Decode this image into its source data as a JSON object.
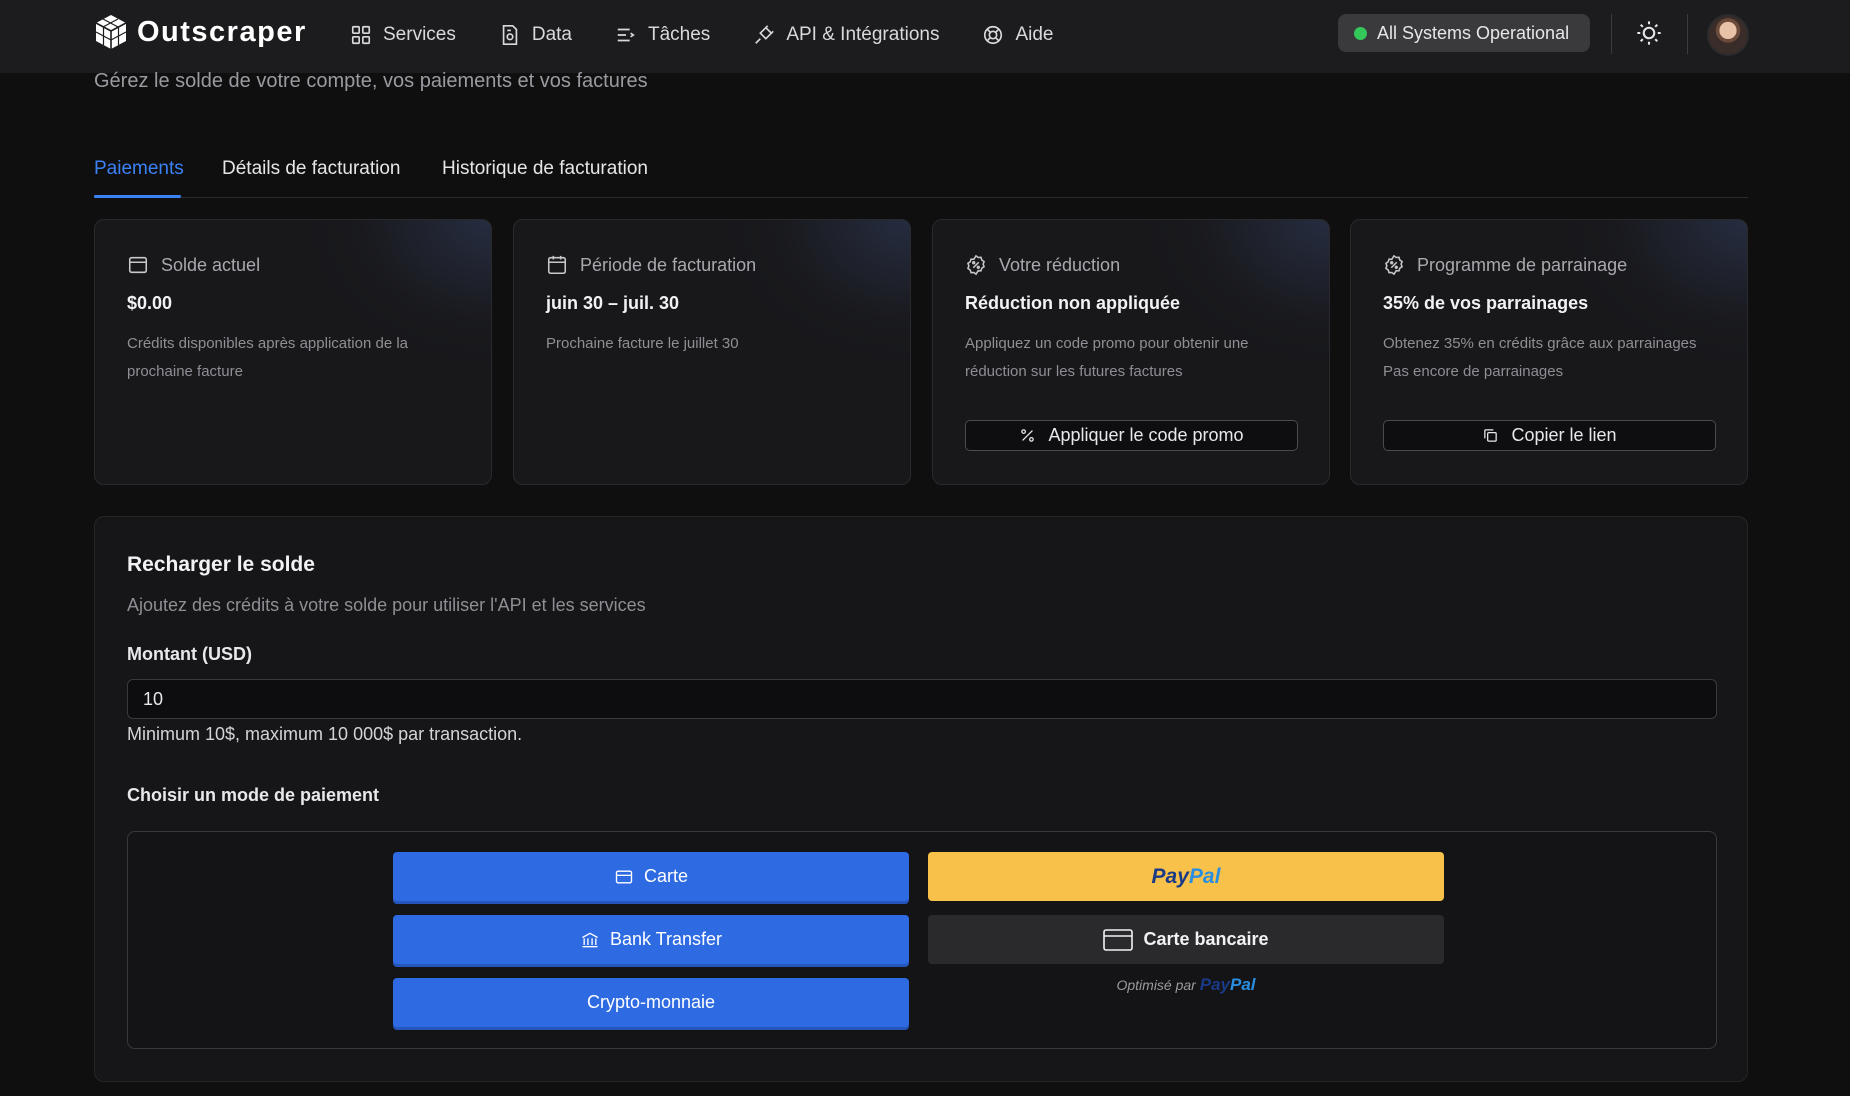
{
  "nav": {
    "brand": "Outscraper",
    "items": [
      {
        "label": "Services",
        "icon": "grid-icon"
      },
      {
        "label": "Data",
        "icon": "data-file-icon"
      },
      {
        "label": "Tâches",
        "icon": "tasks-list-icon"
      },
      {
        "label": "API & Intégrations",
        "icon": "plug-icon"
      },
      {
        "label": "Aide",
        "icon": "lifebuoy-icon"
      }
    ],
    "status": "All Systems Operational",
    "status_color": "#34c759"
  },
  "page": {
    "subtitle": "Gérez le solde de votre compte, vos paiements et vos factures"
  },
  "tabs": [
    {
      "label": "Paiements",
      "active": true
    },
    {
      "label": "Détails de facturation",
      "active": false
    },
    {
      "label": "Historique de facturation",
      "active": false
    }
  ],
  "cards": [
    {
      "title": "Solde actuel",
      "value": "$0.00",
      "desc": "Crédits disponibles après application de la prochaine facture",
      "icon": "wallet-icon"
    },
    {
      "title": "Période de facturation",
      "value": "juin 30 – juil. 30",
      "desc": "Prochaine facture le juillet 30",
      "icon": "calendar-icon"
    },
    {
      "title": "Votre réduction",
      "value": "Réduction non appliquée",
      "desc": "Appliquez un code promo pour obtenir une réduction sur les futures factures",
      "button": "Appliquer le code promo",
      "icon": "discount-badge-icon"
    },
    {
      "title": "Programme de parrainage",
      "value": "35% de vos parrainages",
      "desc": "Obtenez 35% en crédits grâce aux parrainages",
      "desc2": "Pas encore de parrainages",
      "button": "Copier le lien",
      "icon": "referral-badge-icon"
    }
  ],
  "recharge": {
    "title": "Recharger le solde",
    "desc": "Ajoutez des crédits à votre solde pour utiliser l'API et les services",
    "amount_label": "Montant (USD)",
    "amount_value": "10",
    "hint": "Minimum 10$, maximum 10 000$ par transaction.",
    "method_label": "Choisir un mode de paiement",
    "methods": {
      "card": "Carte",
      "bank": "Bank Transfer",
      "crypto": "Crypto-monnaie",
      "paypal_a": "Pay",
      "paypal_b": "Pal",
      "bank_card": "Carte bancaire",
      "powered": "Optimisé par"
    }
  },
  "colors": {
    "accent": "#3b82f6",
    "primary_button": "#2e6be3",
    "paypal": "#f7c14a"
  }
}
